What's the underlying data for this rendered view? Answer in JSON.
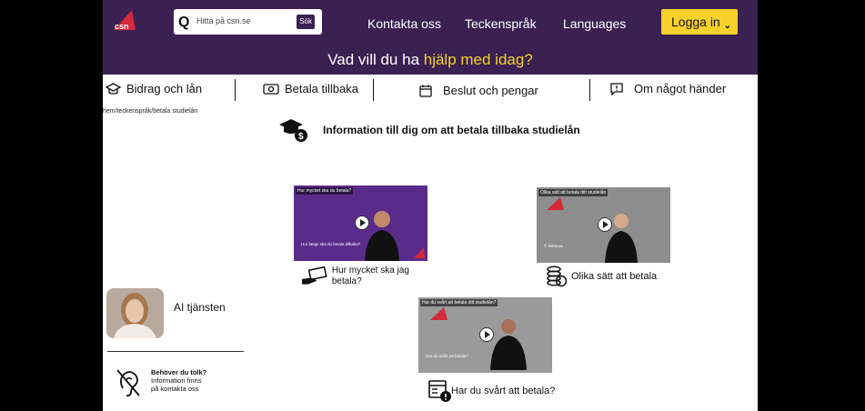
{
  "header": {
    "logo_text": "csn",
    "search": {
      "placeholder": "Hitta på csn.se",
      "button_label": "Sök"
    },
    "nav": [
      "Kontakta oss",
      "Teckenspråk",
      "Languages"
    ],
    "login_label": "Logga in",
    "question_prefix": "Vad vill du ha ",
    "question_highlight": "hjälp med idag?"
  },
  "categories": [
    "Bidrag och lån",
    "Betala tillbaka",
    "Beslut och pengar",
    "Om något händer"
  ],
  "breadcrumb": "hem/teckenspråk/betala studielån",
  "info_title": "Information till dig om att betala tillbaka studielån",
  "videos": [
    {
      "title": "Hur mycket ska du betala?",
      "caption": "Hur länge ska du betala tillbaka?",
      "label": "Hur mycket ska jag betala?"
    },
    {
      "title": "Olika sätt att betala ditt studielån",
      "caption": "© Netnura",
      "label": "Olika sätt att betala"
    },
    {
      "title": "Har du svårt att betala ditt studielån?",
      "caption": "Har du svårt att betala?",
      "label": "Har du svårt att betala?"
    }
  ],
  "ai": {
    "label": "AI tjänsten"
  },
  "interpreter": {
    "title": "Behöver du tolk?",
    "line1": "Information finns",
    "line2": "på kontakta oss"
  },
  "colors": {
    "brand_purple": "#3a2152",
    "accent_yellow": "#f7d02b",
    "csn_red": "#d5283a"
  }
}
